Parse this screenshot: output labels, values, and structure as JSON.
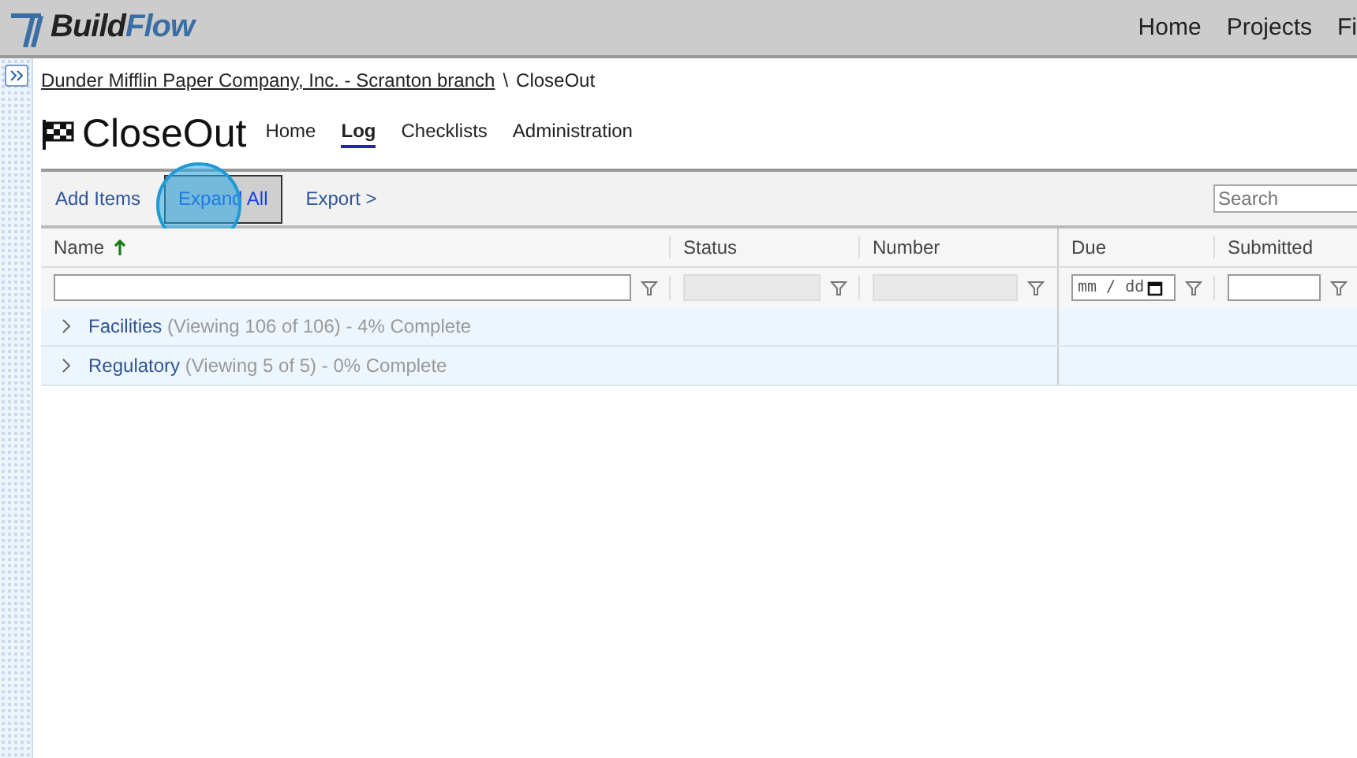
{
  "app": {
    "logo_bold": "Build",
    "logo_light": "Flow"
  },
  "top_nav": [
    "Home",
    "Projects",
    "Fi"
  ],
  "breadcrumb": {
    "link": "Dunder Mifflin Paper Company, Inc. - Scranton branch",
    "separator": "\\",
    "current": "CloseOut"
  },
  "page": {
    "title": "CloseOut"
  },
  "tabs": [
    {
      "label": "Home",
      "selected": false
    },
    {
      "label": "Log",
      "selected": true
    },
    {
      "label": "Checklists",
      "selected": false
    },
    {
      "label": "Administration",
      "selected": false
    }
  ],
  "toolbar": {
    "buttons": [
      {
        "label": "Add Items",
        "pressed": false,
        "clicked": false
      },
      {
        "label": "Expand All",
        "pressed": true,
        "clicked": true
      },
      {
        "label": "Export >",
        "pressed": false,
        "clicked": false
      }
    ],
    "search": {
      "placeholder": "Search"
    }
  },
  "table": {
    "columns": [
      {
        "label": "Name",
        "sorted": true,
        "kind": "text"
      },
      {
        "label": "Status",
        "sorted": false,
        "kind": "disabled"
      },
      {
        "label": "Number",
        "sorted": false,
        "kind": "disabled"
      },
      {
        "label": "Due",
        "sorted": false,
        "kind": "date",
        "filter_value": "mm / dd"
      },
      {
        "label": "Submitted",
        "sorted": false,
        "kind": "text"
      }
    ],
    "groups": [
      {
        "name": "Facilities",
        "detail": "(Viewing 106 of 106) - 4% Complete",
        "expanded": false
      },
      {
        "name": "Regulatory",
        "detail": "(Viewing 5 of 5) - 0% Complete",
        "expanded": false
      }
    ]
  }
}
